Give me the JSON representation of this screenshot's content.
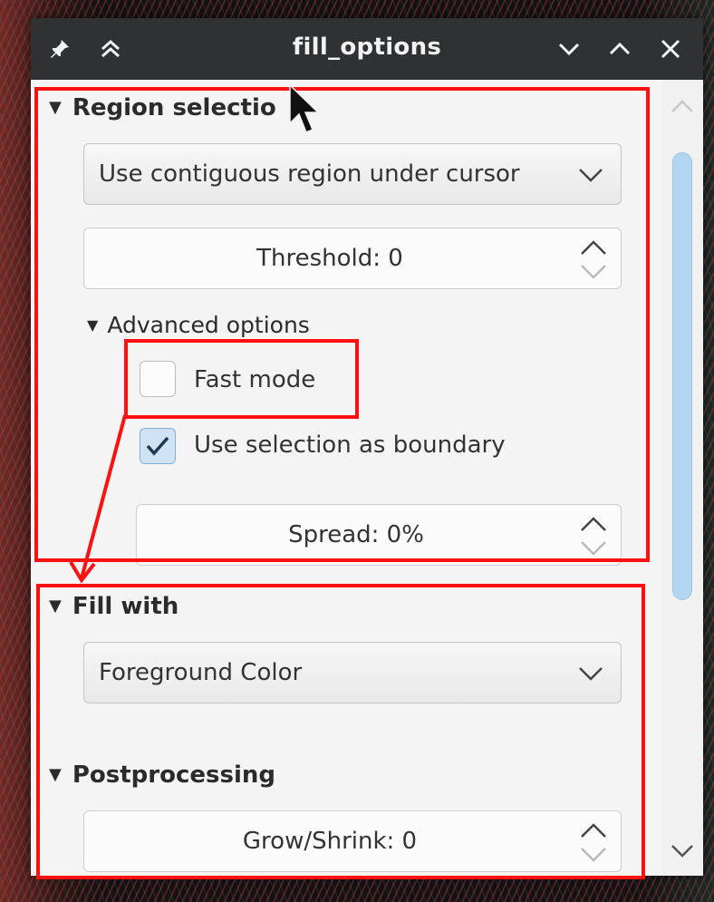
{
  "window": {
    "title": "fill_options",
    "pin_icon": "pin-icon",
    "shade_icon": "double-chevron-up-icon",
    "minimize_icon": "chevron-down-icon",
    "maximize_icon": "chevron-up-icon",
    "close_icon": "close-icon"
  },
  "region_selection": {
    "heading": "Region selectio",
    "mode_select": {
      "value": "Use contiguous region under cursor"
    },
    "threshold": {
      "value": "Threshold: 0"
    },
    "advanced": {
      "heading": "Advanced options",
      "fast_mode": {
        "label": "Fast mode",
        "checked": false
      },
      "use_selection": {
        "label": "Use selection as boundary",
        "checked": true
      },
      "spread": {
        "value": "Spread: 0%"
      }
    }
  },
  "fill_with": {
    "heading": "Fill with",
    "select": {
      "value": "Foreground Color"
    }
  },
  "postprocessing": {
    "heading": "Postprocessing",
    "grow_shrink": {
      "value": "Grow/Shrink: 0"
    }
  },
  "colors": {
    "annotation": "#ff1010",
    "titlebar": "#2f3133",
    "scroll_thumb": "#b3d5ef",
    "check_accent": "#cfe3f4"
  }
}
